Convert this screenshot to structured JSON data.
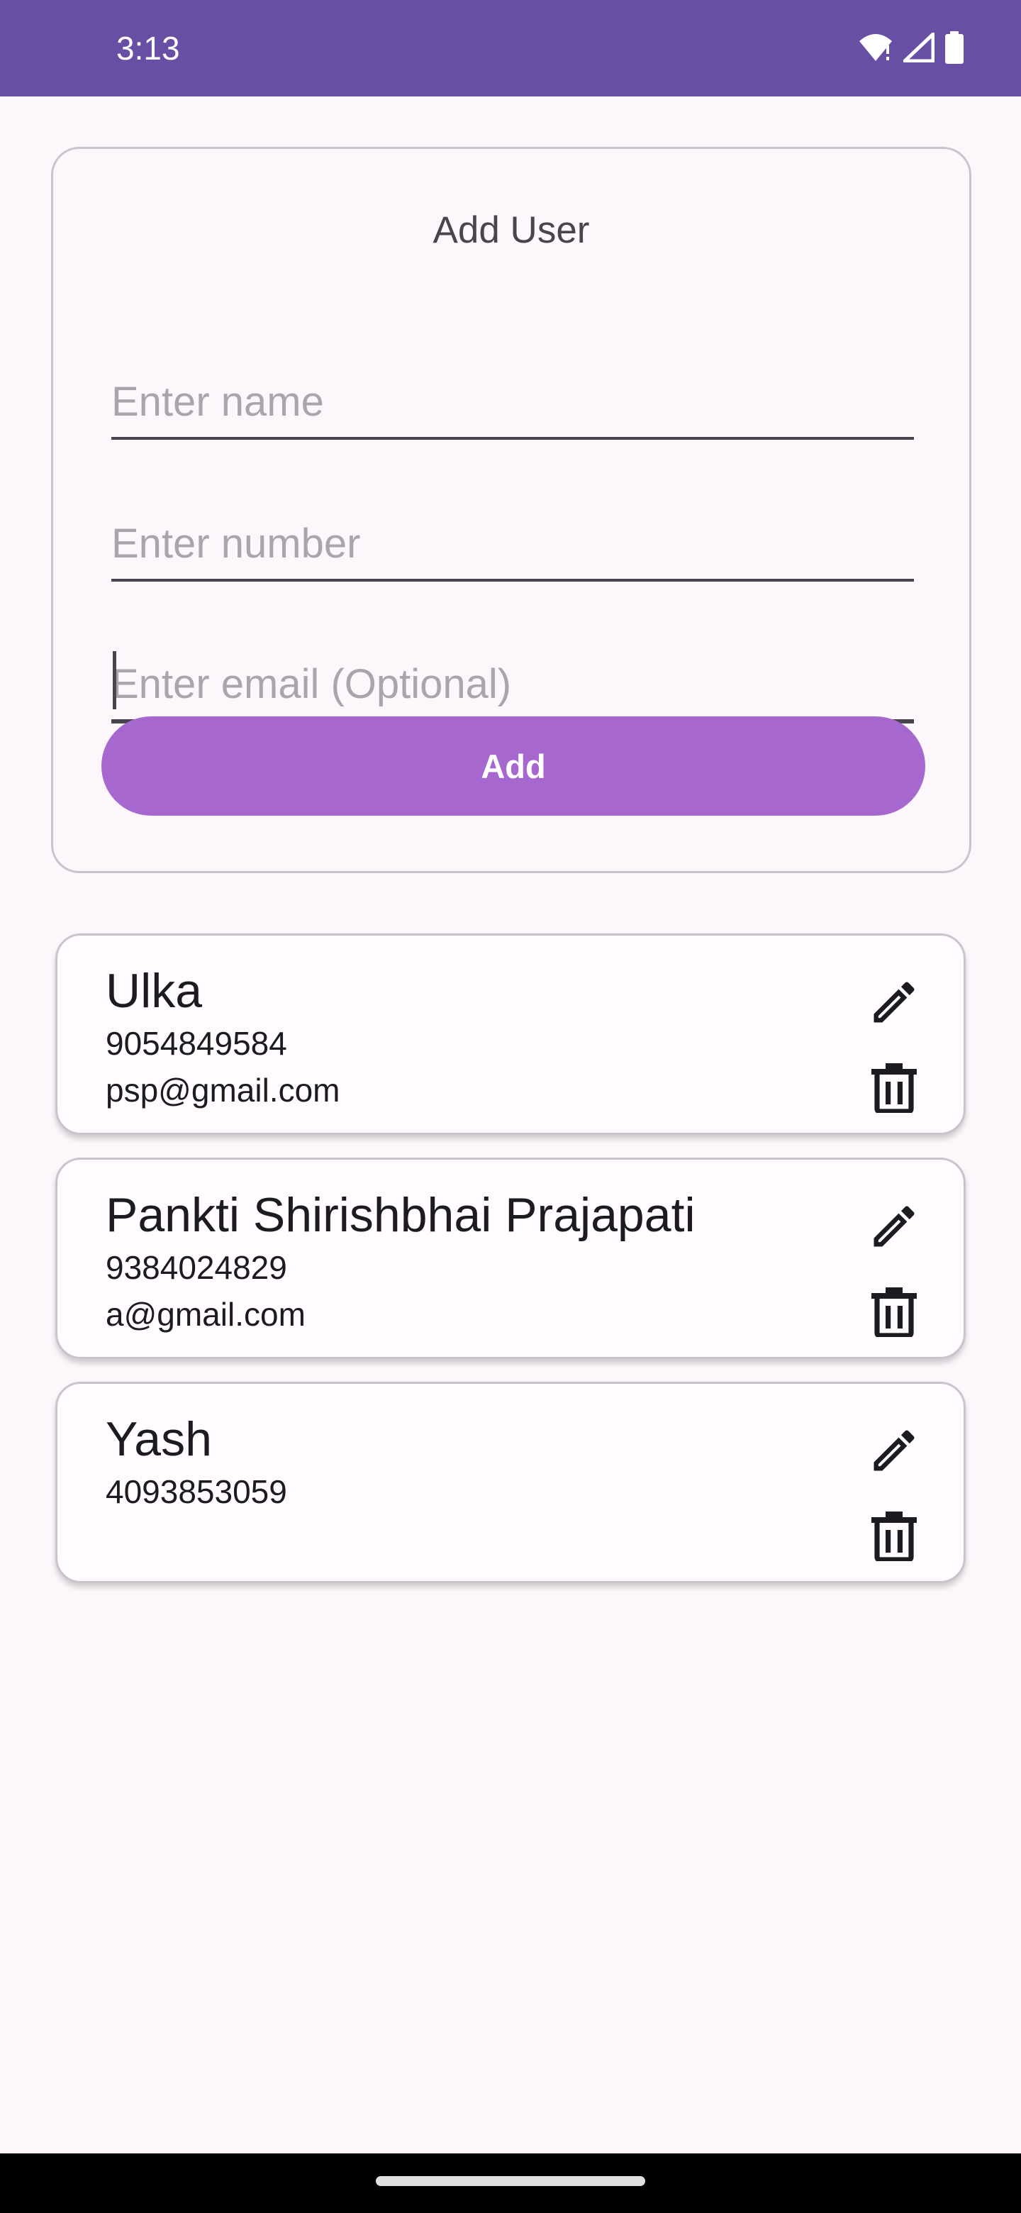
{
  "status_bar": {
    "time": "3:13",
    "icons": [
      "wifi-icon",
      "signal-icon",
      "battery-icon"
    ]
  },
  "add_form": {
    "title": "Add User",
    "name_placeholder": "Enter name",
    "number_placeholder": "Enter number",
    "email_placeholder": "Enter email (Optional)",
    "add_label": "Add"
  },
  "users": [
    {
      "name": "Ulka",
      "phone": "9054849584",
      "email": "psp@gmail.com"
    },
    {
      "name": "Pankti Shirishbhai Prajapati",
      "phone": "9384024829",
      "email": "a@gmail.com"
    },
    {
      "name": "Yash",
      "phone": "4093853059",
      "email": ""
    }
  ],
  "colors": {
    "status_bar": "#6750a4",
    "add_button": "#a667cf",
    "background": "#fdf7fc"
  }
}
